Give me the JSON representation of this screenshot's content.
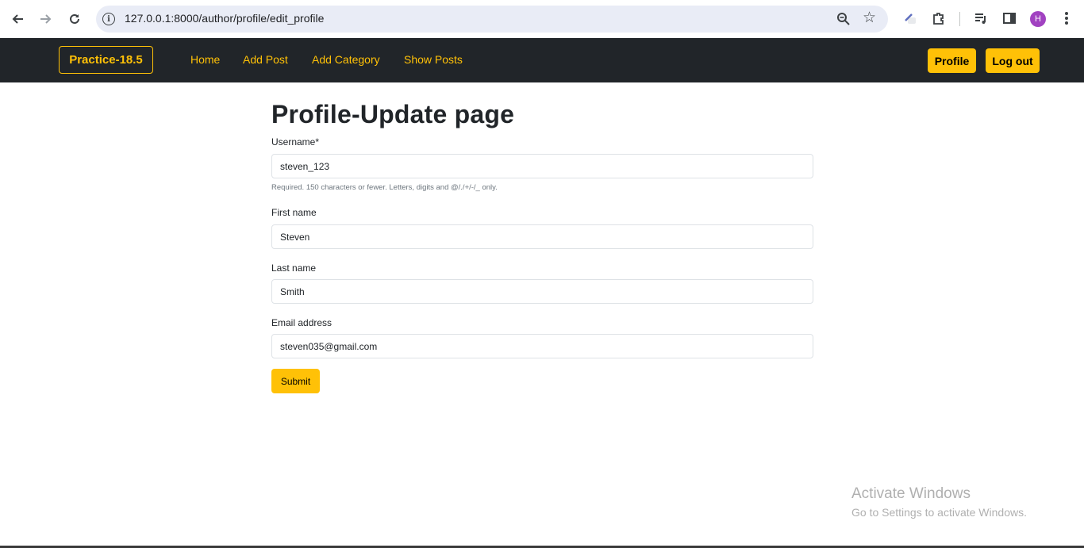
{
  "browser": {
    "url": "127.0.0.1:8000/author/profile/edit_profile",
    "avatar_letter": "H"
  },
  "navbar": {
    "brand": "Practice-18.5",
    "links": [
      "Home",
      "Add Post",
      "Add Category",
      "Show Posts"
    ],
    "profile_label": "Profile",
    "logout_label": "Log out"
  },
  "page": {
    "title": "Profile-Update page"
  },
  "form": {
    "username_label": "Username*",
    "username_value": "steven_123",
    "username_help": "Required. 150 characters or fewer. Letters, digits and @/./+/-/_ only.",
    "first_name_label": "First name",
    "first_name_value": "Steven",
    "last_name_label": "Last name",
    "last_name_value": "Smith",
    "email_label": "Email address",
    "email_value": "steven035@gmail.com",
    "submit_label": "Submit"
  },
  "watermark": {
    "line1": "Activate Windows",
    "line2": "Go to Settings to activate Windows."
  },
  "colors": {
    "accent": "#ffc107",
    "navbar_bg": "#212529"
  }
}
